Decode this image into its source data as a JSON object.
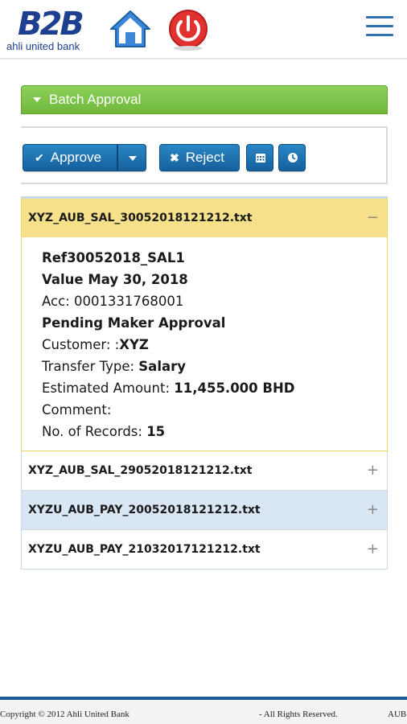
{
  "header": {
    "logo_mark": "B2B",
    "logo_text": "ahli united bank",
    "home_icon": "home-icon",
    "power_icon": "power-icon",
    "menu_icon": "hamburger-menu-icon"
  },
  "panel": {
    "title": "Batch Approval"
  },
  "toolbar": {
    "approve_label": "Approve",
    "reject_label": "Reject",
    "icon_buttons": [
      "calendar-icon",
      "clock-icon"
    ]
  },
  "batches": [
    {
      "file": "XYZ_AUB_SAL_30052018121212.txt",
      "toggle": "−",
      "expanded": true,
      "details": {
        "ref": "Ref30052018_SAL1",
        "value_date": "Value May 30, 2018",
        "acc": "Acc: 0001331768001",
        "status": "Pending Maker Approval",
        "customer_label": "Customer: :",
        "customer_value": "XYZ",
        "transfer_type_label": "Transfer Type: ",
        "transfer_type_value": "Salary",
        "estimated_amount_label": "Estimated Amount: ",
        "estimated_amount_value": "11,455.000 BHD",
        "comment_label": "Comment:",
        "records_label": "No. of Records: ",
        "records_value": "15"
      }
    },
    {
      "file": "XYZ_AUB_SAL_29052018121212.txt",
      "toggle": "+"
    },
    {
      "file": "XYZU_AUB_PAY_20052018121212.txt",
      "toggle": "+"
    },
    {
      "file": "XYZU_AUB_PAY_21032017121212.txt",
      "toggle": "+"
    }
  ],
  "footer": {
    "copyright": "Copyright © 2012 Ahli United Bank",
    "rights": "- All Rights Reserved.",
    "aub": "AUB"
  },
  "colors": {
    "brand_blue": "#1c3f8f",
    "panel_green": "#6fb83c",
    "button_blue": "#16609d",
    "open_row_yellow": "#f7e08a",
    "highlight_row_blue": "#d9e6f4"
  }
}
